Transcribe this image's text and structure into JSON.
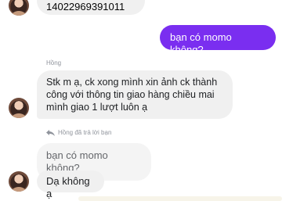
{
  "messages": {
    "m1_text": "14022969391011",
    "m2_text": "bạn có momo không?",
    "m3_sender": "Hồng",
    "m3_lines": [
      "Stk m ạ, ck xong mình xin ảnh ck thành",
      "công với thông tin giao hàng chiều mai",
      "mình giao 1 lượt luôn ạ"
    ],
    "reply_note": "Hồng đã trả lời bạn",
    "quoted_text": "bạn có momo không?",
    "m4_text": "Dạ không ạ"
  },
  "colors": {
    "outgoing_bubble": "#7a2ef0",
    "incoming_bubble": "#f0f0f0",
    "meta_text": "#90949c"
  }
}
